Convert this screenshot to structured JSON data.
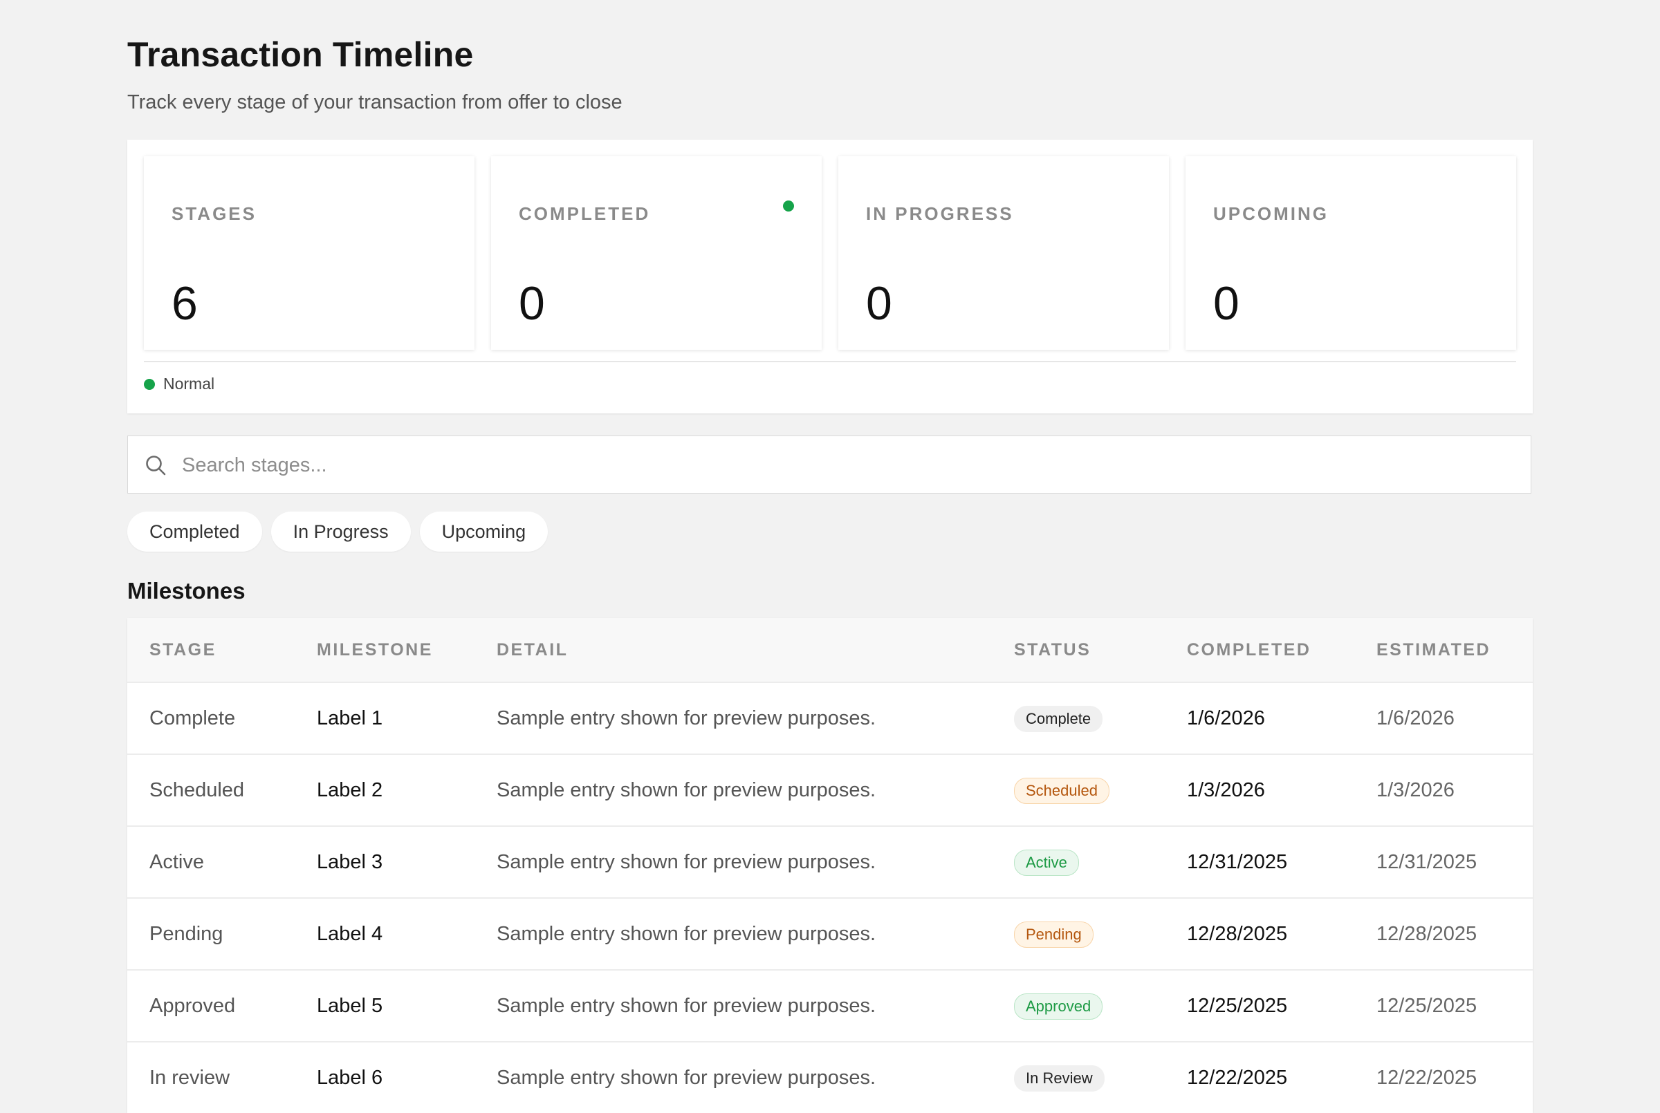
{
  "header": {
    "title": "Transaction Timeline",
    "subtitle": "Track every stage of your transaction from offer to close"
  },
  "stats": [
    {
      "label": "STAGES",
      "value": "6"
    },
    {
      "label": "COMPLETED",
      "value": "0"
    },
    {
      "label": "IN PROGRESS",
      "value": "0"
    },
    {
      "label": "UPCOMING",
      "value": "0"
    }
  ],
  "status_indicator": {
    "label": "Normal",
    "color": "#16a34a"
  },
  "search": {
    "placeholder": "Search stages...",
    "value": ""
  },
  "filters": [
    "Completed",
    "In Progress",
    "Upcoming"
  ],
  "milestones": {
    "title": "Milestones",
    "columns": [
      "STAGE",
      "MILESTONE",
      "DETAIL",
      "STATUS",
      "COMPLETED",
      "ESTIMATED"
    ],
    "rows": [
      {
        "stage": "Complete",
        "milestone": "Label 1",
        "detail": "Sample entry shown for preview purposes.",
        "status": "Complete",
        "completed": "1/6/2026",
        "estimated": "1/6/2026"
      },
      {
        "stage": "Scheduled",
        "milestone": "Label 2",
        "detail": "Sample entry shown for preview purposes.",
        "status": "Scheduled",
        "completed": "1/3/2026",
        "estimated": "1/3/2026"
      },
      {
        "stage": "Active",
        "milestone": "Label 3",
        "detail": "Sample entry shown for preview purposes.",
        "status": "Active",
        "completed": "12/31/2025",
        "estimated": "12/31/2025"
      },
      {
        "stage": "Pending",
        "milestone": "Label 4",
        "detail": "Sample entry shown for preview purposes.",
        "status": "Pending",
        "completed": "12/28/2025",
        "estimated": "12/28/2025"
      },
      {
        "stage": "Approved",
        "milestone": "Label 5",
        "detail": "Sample entry shown for preview purposes.",
        "status": "Approved",
        "completed": "12/25/2025",
        "estimated": "12/25/2025"
      },
      {
        "stage": "In review",
        "milestone": "Label 6",
        "detail": "Sample entry shown for preview purposes.",
        "status": "In Review",
        "completed": "12/22/2025",
        "estimated": "12/22/2025"
      }
    ]
  },
  "colors": {
    "background": "#f2f2f2",
    "accent_green": "#16a34a",
    "badge_orange": "#b4560d",
    "badge_green": "#1c9a44"
  },
  "icons": {
    "search": "search-icon",
    "status_dot": "status-dot-icon"
  }
}
